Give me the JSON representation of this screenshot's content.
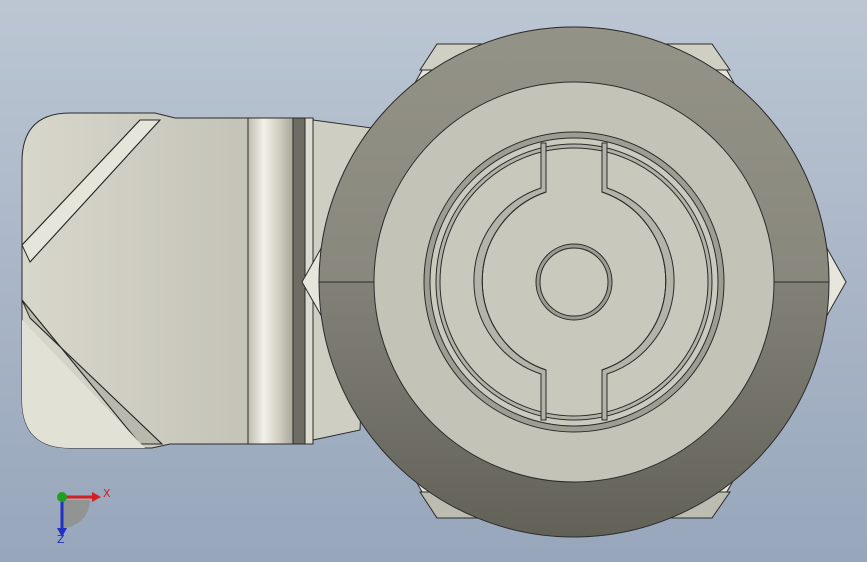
{
  "viewport": {
    "background_top": "#b9c3d1",
    "background_bottom": "#9aa9be"
  },
  "triad": {
    "x_label": "X",
    "z_label": "Z",
    "x_color": "#d42020",
    "y_color": "#20a020",
    "z_color": "#2030c0"
  },
  "model": {
    "body_color": "#c9c8bd",
    "ring_color": "#8e8d82",
    "face_color": "#c7c6bb",
    "edge_color": "#2b2b2b"
  }
}
